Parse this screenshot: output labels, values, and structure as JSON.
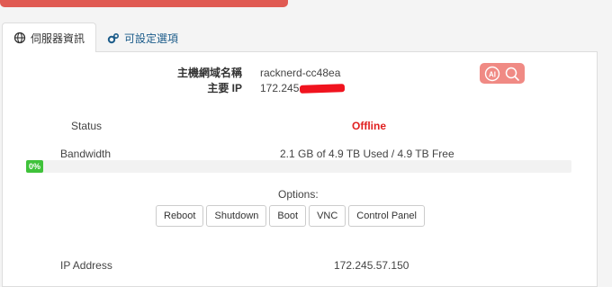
{
  "tabs": [
    {
      "label": "伺服器資訊",
      "icon": "globe-icon",
      "active": true
    },
    {
      "label": "可設定選項",
      "icon": "cogs-icon",
      "active": false
    }
  ],
  "host": {
    "hostname_label": "主機網域名稱",
    "hostname": "racknerd-cc48ea",
    "ip_label": "主要 IP",
    "ip_visible": "172.245"
  },
  "actions": {
    "ai_icon": "ai-icon",
    "search_icon": "search-icon"
  },
  "status": {
    "label": "Status",
    "value": "Offline",
    "color": "#e02020"
  },
  "bandwidth": {
    "label": "Bandwidth",
    "value": "2.1 GB of 4.9 TB Used / 4.9 TB Free",
    "percent_label": "0%",
    "percent": 0,
    "bar_color": "#3fc23a"
  },
  "options": {
    "label": "Options:",
    "buttons": [
      "Reboot",
      "Shutdown",
      "Boot",
      "VNC",
      "Control Panel"
    ]
  },
  "ip_address": {
    "label": "IP Address",
    "value": "172.245.57.150"
  },
  "colors": {
    "alert": "#e05a52",
    "tab_link": "#1c5c8a",
    "ai_group": "#f08a84"
  }
}
